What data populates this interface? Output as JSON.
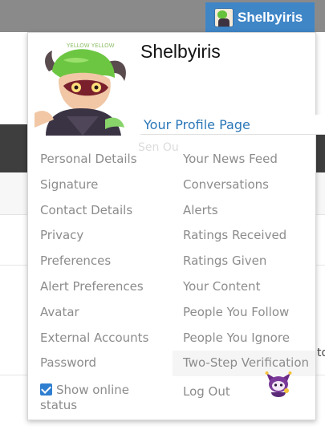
{
  "topbar": {
    "username": "Shelbyiris"
  },
  "background": {
    "search_placeholder_fragment": "Sen Ou",
    "peek_text": "to"
  },
  "account_menu": {
    "display_name": "Shelbyiris",
    "profile_link": "Your Profile Page",
    "left_items": [
      "Personal Details",
      "Signature",
      "Contact Details",
      "Privacy",
      "Preferences",
      "Alert Preferences",
      "Avatar",
      "External Accounts",
      "Password"
    ],
    "right_items": [
      "Your News Feed",
      "Conversations",
      "Alerts",
      "Ratings Received",
      "Ratings Given",
      "Your Content",
      "People You Follow",
      "People You Ignore",
      "Two-Step Verification",
      "Log Out"
    ],
    "show_online_status": {
      "label": "Show online status",
      "checked": true
    },
    "avatar_caption": "YELLOW YELLOW",
    "colors": {
      "accent": "#3f86c7",
      "link": "#2b77b8",
      "checkbox": "#2f7fd0",
      "muted_text": "#8c8c8c"
    },
    "icons": {
      "pet": "jester-cat-icon"
    }
  }
}
